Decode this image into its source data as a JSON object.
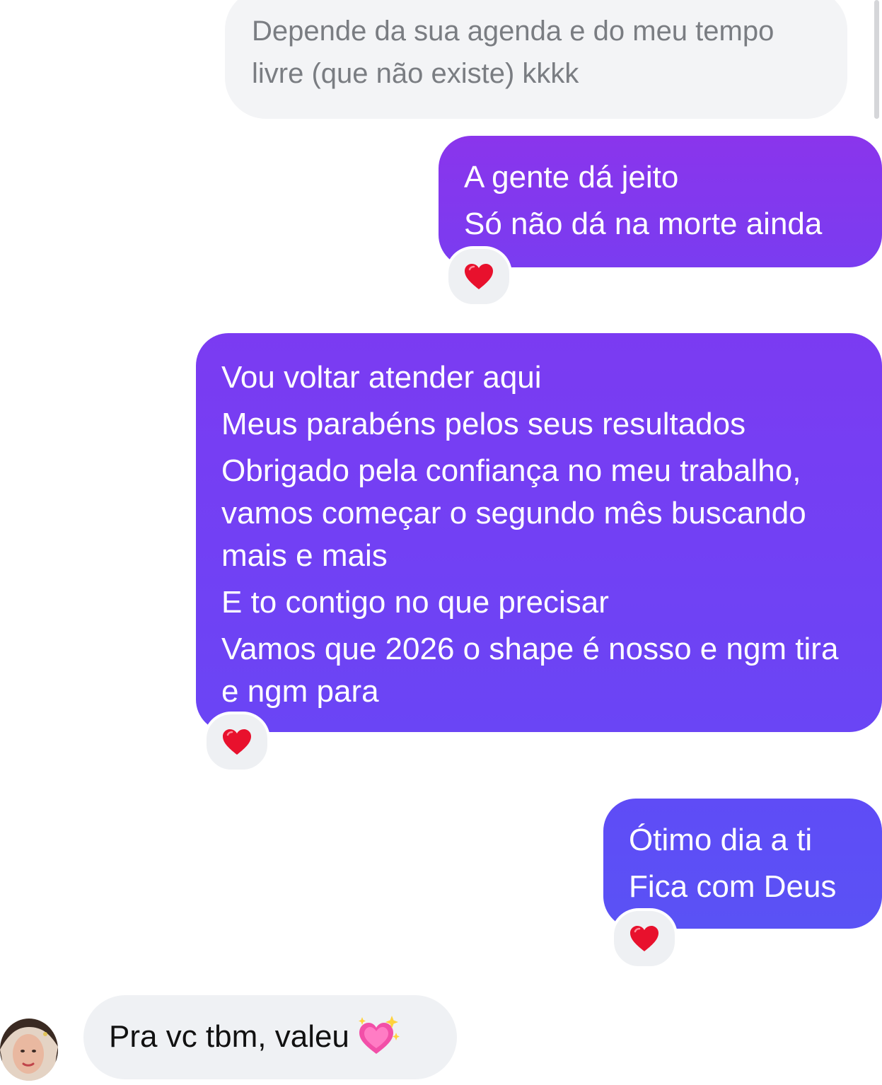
{
  "messages": [
    {
      "id": "msg1",
      "direction": "incoming",
      "lines": [
        "Depende da sua agenda e do meu tempo",
        "livre (que não existe) kkkk"
      ]
    },
    {
      "id": "msg2",
      "direction": "outgoing",
      "lines": [
        "A gente dá jeito",
        "Só não dá na morte ainda"
      ],
      "reaction": "red-heart"
    },
    {
      "id": "msg3",
      "direction": "outgoing",
      "lines": [
        "Vou voltar atender aqui",
        "Meus parabéns pelos seus resultados",
        "Obrigado pela confiança no meu trabalho, vamos começar o segundo mês buscando mais e mais",
        "E to contigo no que precisar",
        "Vamos que 2026 o shape é nosso e ngm tira e ngm para"
      ],
      "reaction": "red-heart"
    },
    {
      "id": "msg4",
      "direction": "outgoing",
      "lines": [
        "Ótimo dia a ti",
        "Fica com Deus"
      ],
      "reaction": "red-heart"
    },
    {
      "id": "msg5",
      "direction": "incoming",
      "text": "Pra vc tbm, valeu",
      "emoji": "sparkling-heart",
      "sender_avatar": "avatar"
    }
  ],
  "colors": {
    "incoming_bg": "#eff1f4",
    "outgoing_top": "#8a35ec",
    "outgoing_bottom": "#5a52f5",
    "heart": "#e8112d"
  }
}
